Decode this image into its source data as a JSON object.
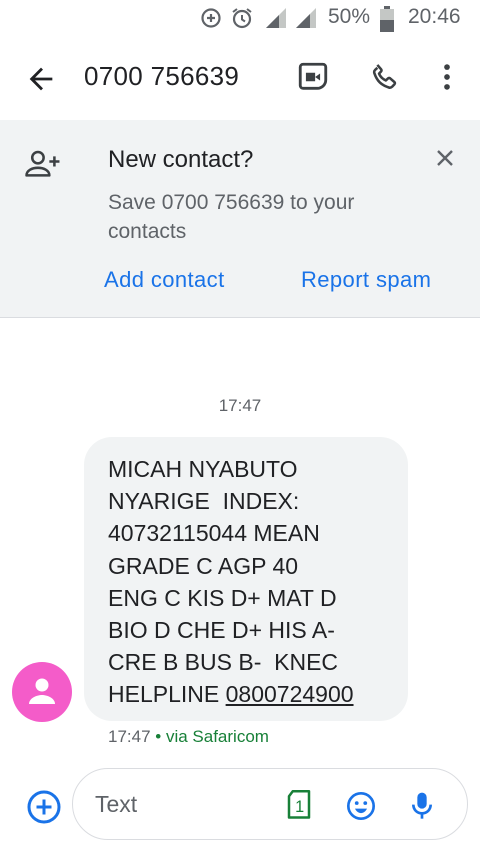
{
  "status_bar": {
    "battery_percent": "50%",
    "time": "20:46",
    "icons": [
      "data-saver-icon",
      "alarm-icon",
      "signal-icon",
      "signal-icon",
      "battery-icon"
    ]
  },
  "app_bar": {
    "title": "0700 756639",
    "icons": [
      "back-arrow-icon",
      "video-call-icon",
      "phone-icon",
      "more-vert-icon"
    ]
  },
  "banner": {
    "title": "New contact?",
    "body": "Save 0700 756639 to your contacts",
    "add_contact": "Add contact",
    "report_spam": "Report spam",
    "icons": [
      "person-add-icon",
      "close-icon"
    ]
  },
  "conversation": {
    "timestamp": "17:47",
    "message_lines": [
      "MICAH NYABUTO",
      "NYARIGE  INDEX:",
      "40732115044 MEAN",
      "GRADE C AGP 40",
      "ENG C KIS D+ MAT D",
      "BIO D CHE D+ HIS A-",
      "CRE B BUS B-  KNEC",
      "HELPLINE "
    ],
    "message_link": "0800724900",
    "meta_time": "17:47",
    "meta_sep": " • ",
    "meta_via": "via Safaricom",
    "avatar_color": "#f45cc9"
  },
  "compose": {
    "placeholder": "Text",
    "sim_label": "1",
    "icons": [
      "add-circle-icon",
      "sim-icon",
      "emoji-icon",
      "mic-icon"
    ]
  },
  "colors": {
    "accent": "#1a73e8",
    "banner_bg": "#f1f3f4",
    "bubble_bg": "#f1f3f4",
    "via_green": "#188038"
  }
}
